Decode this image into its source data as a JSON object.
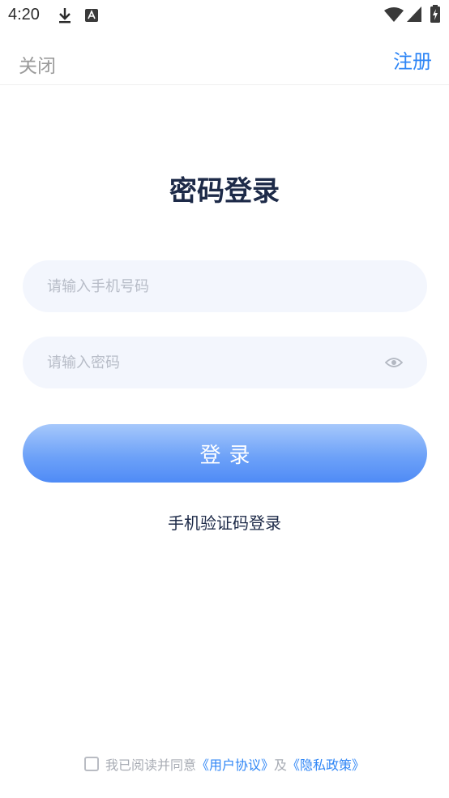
{
  "status_bar": {
    "time": "4:20",
    "icons": [
      "download-icon",
      "app-notification-icon",
      "wifi-icon",
      "signal-icon",
      "battery-charging-icon"
    ]
  },
  "header": {
    "close_label": "关闭",
    "register_label": "注册"
  },
  "page": {
    "title": "密码登录"
  },
  "form": {
    "phone_placeholder": "请输入手机号码",
    "password_placeholder": "请输入密码",
    "login_label": "登录",
    "sms_login_label": "手机验证码登录"
  },
  "agreement": {
    "prefix": "我已阅读并同意",
    "user_agreement": "《用户协议》",
    "and": "及",
    "privacy_policy": "《隐私政策》",
    "checked": false
  },
  "colors": {
    "accent": "#2f86f6",
    "title": "#1d2a48",
    "input_bg": "#f3f6fd",
    "button_top": "#a6c8fb",
    "button_bottom": "#4f8bf6"
  }
}
